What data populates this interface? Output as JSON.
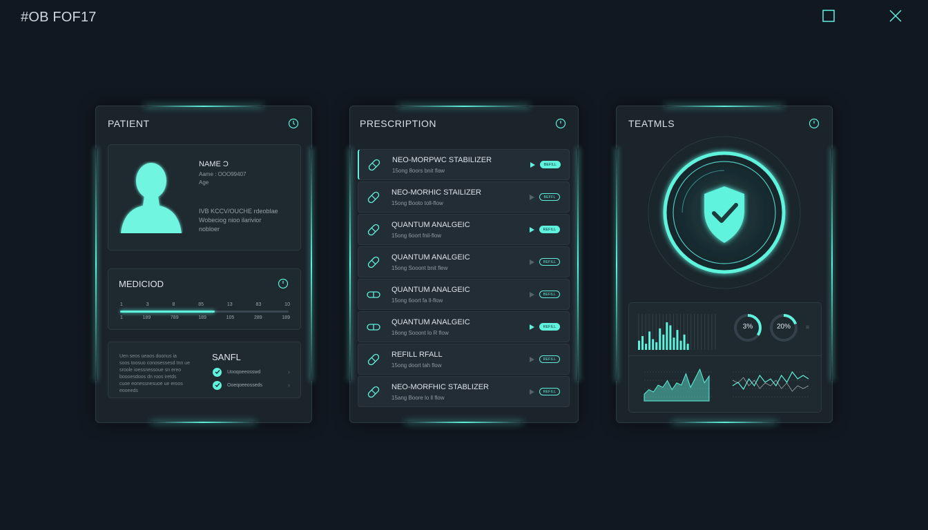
{
  "window": {
    "title": "#OB FOF17",
    "maximize_icon": "square-icon",
    "close_icon": "x-icon"
  },
  "colors": {
    "background": "#121821",
    "panel": "#1b232b",
    "accent": "#5ff2dc"
  },
  "patient_panel": {
    "title": "PATIENT",
    "profile": {
      "name_label": "NAME Ɔ",
      "id_line": "Aame : OOO99407",
      "age_label": "Age",
      "notes": [
        "IVB KCCV/OUCHE rdeoblae",
        "Wobeciog nioo ilarivior",
        "nobloer"
      ]
    },
    "medication": {
      "title": "MEDICIOD",
      "ticks_top": [
        "1",
        "3",
        "8",
        "85",
        "13",
        "83",
        "10"
      ],
      "ticks_bottom": [
        "1",
        "189",
        "789",
        "189",
        "105",
        "289",
        "189"
      ],
      "progress": 0.56
    },
    "sanfl": {
      "title": "SANFL",
      "paragraph": [
        "Uen seos ueaos doonus ia",
        "soos toosuo conosessesd tnn ue",
        "sroole ioessnessoue sn ereo",
        "boooesdoos dn roos iretds",
        "cuoe eonessnesuoe ue eroos",
        "eooeeds"
      ],
      "items": [
        {
          "label": "Uooqoeeosswd"
        },
        {
          "label": "Ooeqoeeosseds"
        }
      ]
    }
  },
  "prescription_panel": {
    "title": "PRESCRIPTION",
    "items": [
      {
        "name": "NEO-MORPWC STABILIZER",
        "sub": "15ong 8oors bnit flaw",
        "icon": "pill-icon",
        "active": true,
        "badge": "BEFILL"
      },
      {
        "name": "NEO-MORHIC STAILIZER",
        "sub": "15ong Booto toll-flow",
        "icon": "pill-icon",
        "active": false,
        "badge": "BEFFL"
      },
      {
        "name": "QUANTUM ANALGEIC",
        "sub": "15ong 6oort fnil-flow",
        "icon": "pill-icon",
        "active": true,
        "badge": "REFILL"
      },
      {
        "name": "QUANTUM ANALGEIC",
        "sub": "15ong Sooont bnit flew",
        "icon": "pill-icon",
        "active": false,
        "badge": "REFILL"
      },
      {
        "name": "QUANTUM ANALGEIC",
        "sub": "15ong 6oort fa ll-flow",
        "icon": "capsule-icon",
        "active": false,
        "badge": "BEFILL"
      },
      {
        "name": "QUANTUM ANALGEIC",
        "sub": "16ong Sooont lo R flow",
        "icon": "capsule-icon",
        "active": true,
        "badge": "REFILL"
      },
      {
        "name": "REFILL RFALL",
        "sub": "15ong doort tah flow",
        "icon": "pill-icon",
        "active": false,
        "badge": "REFILL"
      },
      {
        "name": "NEO-MORFHIC STABLIZER",
        "sub": "15ang Boore lo ll flow",
        "icon": "pill-icon",
        "active": false,
        "badge": "REFILL"
      }
    ]
  },
  "teatmls_panel": {
    "title": "TEATMLS",
    "shield_icon": "shield-check-icon",
    "bar_values": [
      6,
      9,
      4,
      12,
      7,
      5,
      14,
      10,
      18,
      16,
      8,
      13,
      6,
      10,
      4
    ],
    "donuts": [
      {
        "label": "3%",
        "value": 0.35
      },
      {
        "label": "20%",
        "value": 0.2
      }
    ],
    "area_values": [
      3,
      5,
      4,
      7,
      6,
      9,
      5,
      8,
      7,
      12,
      6,
      10,
      14,
      8,
      11
    ],
    "line_values": [
      4,
      5,
      3,
      6,
      4,
      7,
      5,
      6,
      4,
      7,
      5,
      8,
      6,
      7,
      6
    ]
  }
}
